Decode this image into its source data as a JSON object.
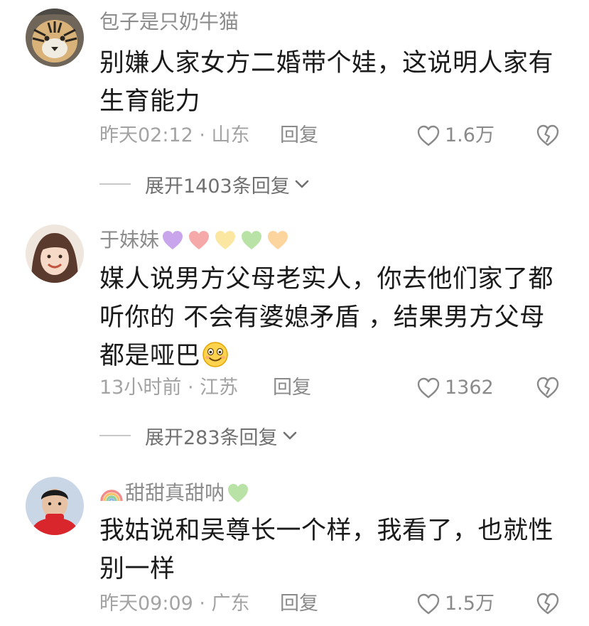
{
  "comments": [
    {
      "username": "包子是只奶牛猫",
      "avatar": "tiger-avatar",
      "lines": [
        "别嫌人家女方二婚带个娃，这说明人家有",
        "生育能力"
      ],
      "time_location": "昨天02:12 · 山东",
      "reply_label": "回复",
      "likes": "1.6万",
      "expand_label": "展开1403条回复"
    },
    {
      "username": "于妹妹",
      "username_hearts": [
        "purple-heart",
        "pink-heart",
        "yellow-heart",
        "green-heart",
        "orange-heart"
      ],
      "avatar": "woman-avatar",
      "lines": [
        "媒人说男方父母老实人，你去他们家了都",
        "听你的 不会有婆媳矛盾 ，结果男方父母",
        "都是哑巴"
      ],
      "inline_emoji": "smiling-face-emoji",
      "time_location": "13小时前 · 江苏",
      "reply_label": "回复",
      "likes": "1362",
      "expand_label": "展开283条回复"
    },
    {
      "username": "甜甜真甜呐",
      "username_prefix_icon": "rainbow-icon",
      "username_suffix_icon": "green-heart",
      "avatar": "boy-avatar",
      "lines": [
        "我姑说和吴尊长一个样，我看了，也就性",
        "别一样"
      ],
      "time_location": "昨天09:09 · 广东",
      "reply_label": "回复",
      "likes": "1.5万"
    }
  ],
  "colors": {
    "text_primary": "#1a1a1a",
    "text_secondary": "#8c8c8c",
    "divider": "#c9c9c9"
  }
}
